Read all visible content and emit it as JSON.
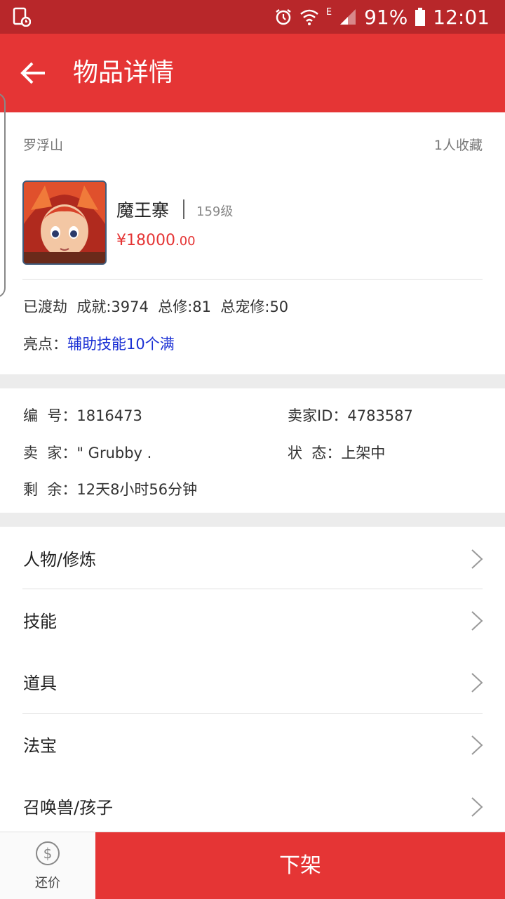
{
  "status_bar": {
    "battery": "91%",
    "time": "12:01",
    "network": "E"
  },
  "app_bar": {
    "title": "物品详情"
  },
  "item": {
    "server": "罗浮山",
    "favorites": "1人收藏",
    "name": "魔王寨",
    "level": "159级",
    "price_int": "¥18000",
    "price_dec": ".00",
    "stats": "已渡劫  成就:3974  总修:81  总宠修:50",
    "highlight_label": "亮点：",
    "highlight_value": "辅助技能10个满"
  },
  "info": {
    "number": "编  号：1816473",
    "seller_id": "卖家ID：4783587",
    "seller": "卖  家：\" Grubby .",
    "status": "状  态：上架中",
    "remaining": "剩  余：12天8小时56分钟"
  },
  "menu": [
    {
      "label": "人物/修炼"
    },
    {
      "label": "技能"
    },
    {
      "label": "道具"
    },
    {
      "label": "法宝"
    },
    {
      "label": "召唤兽/孩子"
    }
  ],
  "bottom": {
    "bargain_label": "还价",
    "delist_label": "下架"
  },
  "colors": {
    "primary": "#e53535",
    "status_bar": "#b8272a",
    "highlight": "#1a2fd4"
  }
}
